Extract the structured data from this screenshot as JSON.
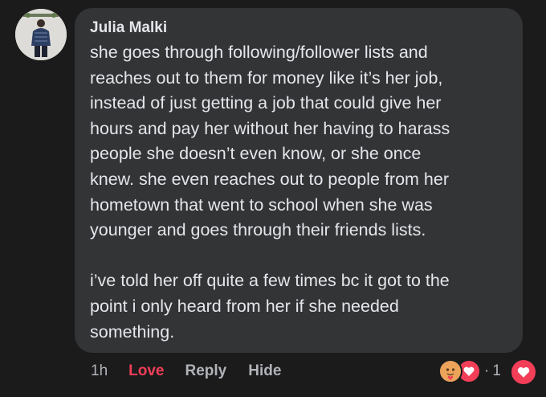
{
  "comment": {
    "author": "Julia Malki",
    "paragraphs": [
      [
        "she goes through following/follower lists and",
        "reaches out to them for money like it’s her job,",
        "instead of just getting a job that could give her",
        "hours and pay her without her having to harass",
        "people she doesn’t even know, or she once",
        "knew. she even reaches out to people from her",
        "hometown that went to school when she was",
        "younger and goes through their friends lists."
      ],
      [
        "i’ve told her off quite a few times bc it got to the",
        "point i only heard from her if she needed",
        "something."
      ]
    ]
  },
  "actions": {
    "time": "1h",
    "love_label": "Love",
    "reply_label": "Reply",
    "hide_label": "Hide"
  },
  "reactions": {
    "separator": "·",
    "count": "1",
    "icons": [
      "care-face-icon",
      "heart-icon"
    ]
  },
  "colors": {
    "background": "#1b1b1c",
    "bubble": "#333436",
    "text": "#e4e6eb",
    "muted": "#b0b3b8",
    "love": "#f33e58"
  }
}
